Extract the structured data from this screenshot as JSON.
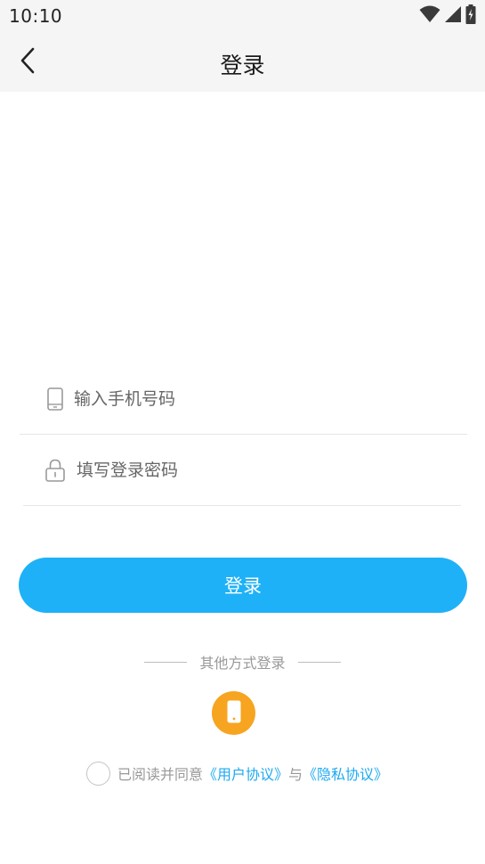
{
  "status_bar": {
    "time": "10:10",
    "icons": [
      "wifi-icon",
      "signal-icon",
      "battery-charging-icon"
    ]
  },
  "nav": {
    "title": "登录",
    "back_icon": "chevron-left-icon"
  },
  "form": {
    "phone_placeholder": "输入手机号码",
    "phone_value": "",
    "phone_icon": "mobile-phone-icon",
    "password_placeholder": "填写登录密码",
    "password_value": "",
    "password_icon": "lock-icon"
  },
  "login_button": "登录",
  "other_login": {
    "label": "其他方式登录",
    "option_icon": "phone-login-icon",
    "option_color": "#f7a420"
  },
  "agreement": {
    "prefix": "已阅读并同意",
    "user_agreement": "《用户协议》",
    "conjunction": "与",
    "privacy_policy": "《隐私协议》",
    "checked": false
  },
  "colors": {
    "accent": "#1eb1f7",
    "link": "#1eaaf1",
    "header_bg": "#f5f5f5"
  }
}
